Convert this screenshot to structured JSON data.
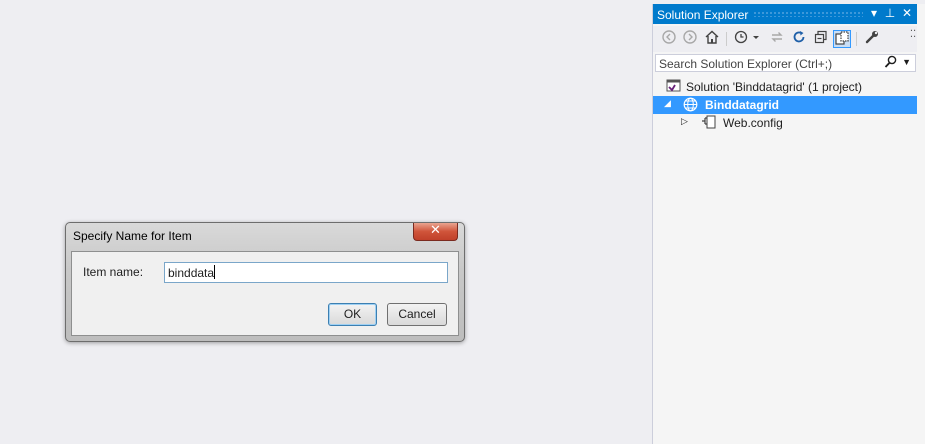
{
  "dialog": {
    "title": "Specify Name for Item",
    "close_glyph": "✕",
    "item_name_label": "Item name:",
    "item_name_value": "binddata",
    "ok_label": "OK",
    "cancel_label": "Cancel"
  },
  "solution_explorer": {
    "title": "Solution Explorer",
    "title_buttons": [
      "▾",
      "⊥",
      "✕"
    ],
    "toolbar_icons": [
      "back-icon",
      "forward-icon",
      "home-icon",
      "history-icon",
      "sync-icon",
      "refresh-icon",
      "collapse-all-icon",
      "show-all-files-icon",
      "properties-icon"
    ],
    "search_placeholder": "Search Solution Explorer (Ctrl+;)",
    "tree": [
      {
        "label": "Solution 'Binddatagrid' (1 project)",
        "level": 0,
        "selected": false,
        "icon": "solution-icon"
      },
      {
        "label": "Binddatagrid",
        "level": 1,
        "selected": true,
        "icon": "web-project-icon",
        "expanded": true
      },
      {
        "label": "Web.config",
        "level": 2,
        "selected": false,
        "icon": "config-file-icon",
        "expanded": false
      }
    ]
  },
  "colors": {
    "accent": "#007acc",
    "selection": "#3399ff",
    "background": "#eeeef2"
  }
}
